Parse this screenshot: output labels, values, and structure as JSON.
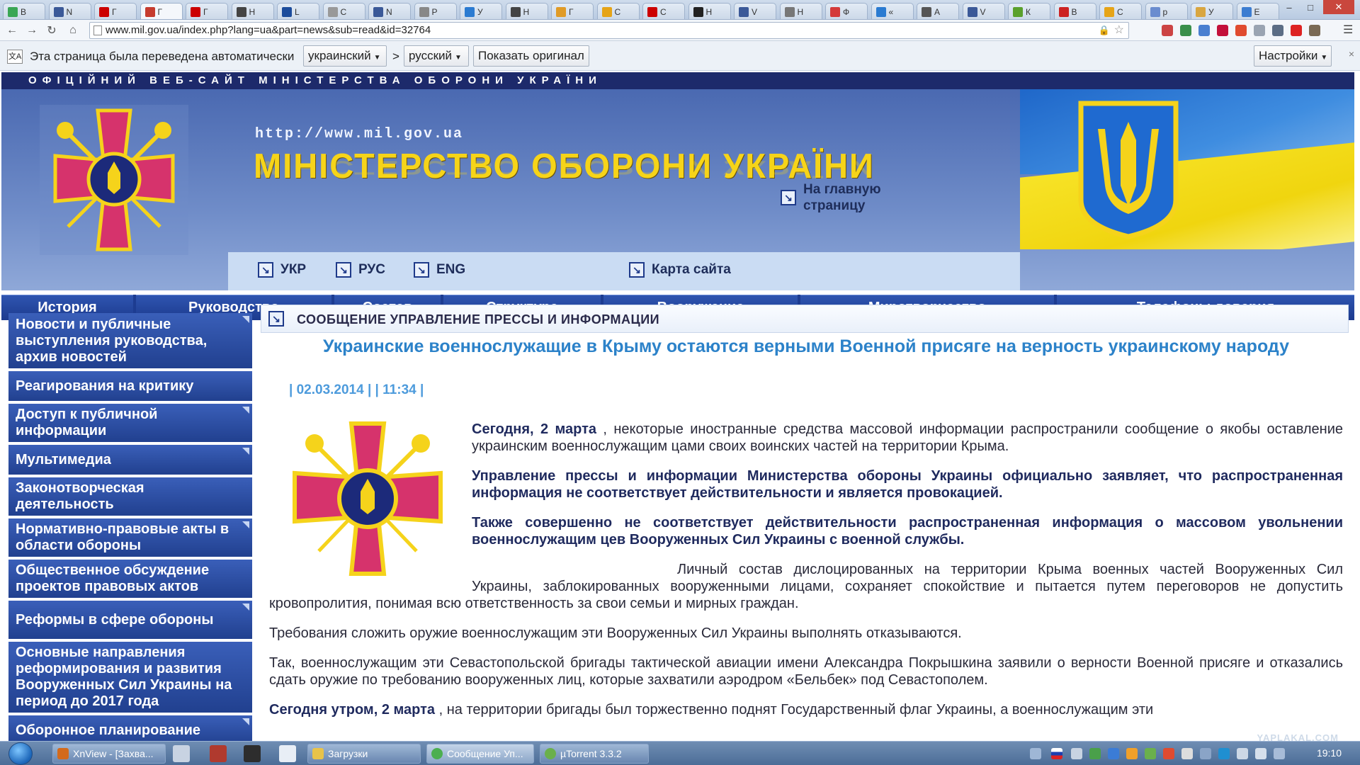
{
  "browser": {
    "tabs": [
      {
        "label": "В",
        "color": "#3aa655"
      },
      {
        "label": "N",
        "color": "#3b5998"
      },
      {
        "label": "Г",
        "color": "#cc0000"
      },
      {
        "label": "Г",
        "color": "#c63c2e"
      },
      {
        "label": "Г",
        "color": "#cc0000"
      },
      {
        "label": "Н",
        "color": "#444444"
      },
      {
        "label": "L",
        "color": "#1c4c9c"
      },
      {
        "label": "С",
        "color": "#999999"
      },
      {
        "label": "N",
        "color": "#3b5998"
      },
      {
        "label": "Р",
        "color": "#888888"
      },
      {
        "label": "У",
        "color": "#2b7bd1"
      },
      {
        "label": "Н",
        "color": "#444444"
      },
      {
        "label": "Г",
        "color": "#e09b27"
      },
      {
        "label": "С",
        "color": "#e6a417"
      },
      {
        "label": "С",
        "color": "#cc0000"
      },
      {
        "label": "Н",
        "color": "#222222"
      },
      {
        "label": "V",
        "color": "#3b5998"
      },
      {
        "label": "Н",
        "color": "#777777"
      },
      {
        "label": "Ф",
        "color": "#d43a3a"
      },
      {
        "label": "«",
        "color": "#2b7bd1"
      },
      {
        "label": "А",
        "color": "#555555"
      },
      {
        "label": "V",
        "color": "#3b5998"
      },
      {
        "label": "К",
        "color": "#5aa02c"
      },
      {
        "label": "В",
        "color": "#cc2222"
      },
      {
        "label": "С",
        "color": "#e6a417"
      },
      {
        "label": "р",
        "color": "#6a8ccf"
      },
      {
        "label": "У",
        "color": "#d9a640"
      },
      {
        "label": "Е",
        "color": "#3c7dd1"
      }
    ],
    "url": "www.mil.gov.ua/index.php?lang=ua&part=news&sub=read&id=32764",
    "window": {
      "minimize": "–",
      "maximize": "□",
      "close": "✕"
    }
  },
  "translate_bar": {
    "message": "Эта страница была переведена автоматически",
    "from_lang": "украинский",
    "arrow": ">",
    "to_lang": "русский",
    "show_original": "Показать оригинал",
    "settings": "Настройки",
    "close": "×"
  },
  "site": {
    "top_line": "ОФІЦІЙНИЙ ВЕБ-САЙТ МІНІСТЕРСТВА ОБОРОНИ УКРАЇНИ",
    "url_text": "http://www.mil.gov.ua",
    "title": "МІНІСТЕРСТВО ОБОРОНИ УКРАЇНИ",
    "lang_links": [
      "УКР",
      "РУС",
      "ENG"
    ],
    "sitemap": "Карта сайта",
    "home": "На главную страницу",
    "colors": {
      "navy": "#1d2a6b",
      "nav_blue": "#21408f",
      "title_yellow": "#f6d419",
      "headline_blue": "#2c82c9"
    }
  },
  "main_nav": [
    "История",
    "Руководство",
    "Состав",
    "Структура",
    "Вооружение",
    "Миротворчество",
    "Телефоны доверия"
  ],
  "sidebar": [
    {
      "label": "Новости и публичные выступления руководства, архив новостей",
      "has_sub": true
    },
    {
      "label": "Реагирования на критику",
      "has_sub": false
    },
    {
      "label": "Доступ к публичной информации",
      "has_sub": true
    },
    {
      "label": "Мультимедиа",
      "has_sub": true
    },
    {
      "label": "Законотворческая деятельность",
      "has_sub": false
    },
    {
      "label": "Нормативно-правовые акты в области обороны",
      "has_sub": true
    },
    {
      "label": "Общественное обсуждение проектов правовых актов",
      "has_sub": false
    },
    {
      "label": "Реформы в сфере обороны",
      "has_sub": true
    },
    {
      "label": "Основные направления реформирования и развития Вооруженных Сил Украины на период до 2017 года",
      "has_sub": false
    },
    {
      "label": "Оборонное планирование",
      "has_sub": true
    }
  ],
  "article": {
    "section": "СООБЩЕНИЕ УПРАВЛЕНИЕ ПРЕССЫ И ИНФОРМАЦИИ",
    "title": "Украинские военнослужащие в Крыму остаются верными Военной присяге на верность украинскому народу",
    "date": "| 02.03.2014 | | 11:34 |",
    "p1_bold": "Сегодня, 2 марта",
    "p1_rest": " , некоторые иностранные средства массовой информации распространили сообщение о якобы оставление украинским военнослужащим цами своих воинских частей на территории Крыма.",
    "p2": "Управление прессы и информации Министерства обороны Украины официально заявляет, что распространенная информация не соответствует действительности и является провокацией.",
    "p3": "Также совершенно не соответствует действительности распространенная информация о массовом увольнении военнослужащим цев Вооруженных Сил Украины с военной службы.",
    "p4": "Личный состав дислоцированных на территории Крыма военных частей Вооруженных Сил Украины, заблокированных вооруженными лицами, сохраняет спокойствие и пытается путем переговоров не допустить кровопролития, понимая всю ответственность за свои семьи и мирных граждан.",
    "p5": "Требования сложить оружие военнослужащим эти Вооруженных Сил Украины выполнять отказываются.",
    "p6": "Так, военнослужащим эти Севастопольской бригады тактической авиации имени Александра Покрышкина заявили о верности Военной присяге и отказались сдать оружие по требованию вооруженных лиц, которые захватили аэродром «Бельбек» под Севастополем.",
    "p7_bold": "Сегодня утром, 2 марта",
    "p7_rest": " , на территории бригады был торжественно поднят Государственный флаг Украины, а военнослужащим эти"
  },
  "taskbar": {
    "items": [
      {
        "label": "XnView - [Захва...",
        "color": "#d36a1c"
      },
      {
        "label": "Загрузки",
        "color": "#e8c34a"
      },
      {
        "label": "Сообщение Уп...",
        "color": "#4caf50"
      },
      {
        "label": "µTorrent 3.3.2",
        "color": "#6ab04c"
      }
    ],
    "clock": "19:10",
    "watermark": "YAPLAKAL.COM"
  }
}
